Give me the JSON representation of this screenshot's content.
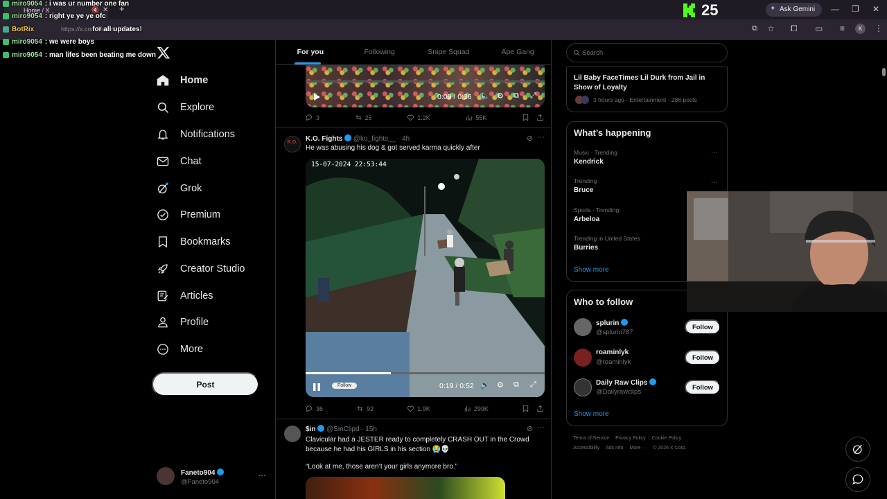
{
  "browser": {
    "tab_title": "Home / X",
    "url": "https://x.com/Faneto904",
    "gemini_label": "Ask Gemini",
    "kick_count": "25"
  },
  "chat": [
    {
      "user": "miro9054",
      "text": ": i was ur number one fan"
    },
    {
      "user": "miro9054",
      "text": ": right ye ye ye ofc"
    },
    {
      "user": "BotRix",
      "text": "for all updates!"
    },
    {
      "user": "miro9054",
      "text": ": we were boys"
    },
    {
      "user": "miro9054",
      "text": ": man lifes been beating me down"
    }
  ],
  "nav": {
    "items": [
      {
        "label": "Home"
      },
      {
        "label": "Explore"
      },
      {
        "label": "Notifications"
      },
      {
        "label": "Chat"
      },
      {
        "label": "Grok"
      },
      {
        "label": "Premium"
      },
      {
        "label": "Bookmarks"
      },
      {
        "label": "Creator Studio"
      },
      {
        "label": "Articles"
      },
      {
        "label": "Profile"
      },
      {
        "label": "More"
      }
    ],
    "post_label": "Post",
    "account_name": "Faneto904",
    "account_handle": "@Faneto904"
  },
  "timeline": {
    "tabs": [
      "For you",
      "Following",
      "Snipe Squad",
      "Ape Gang"
    ],
    "post1": {
      "video_time": "0:09 / 0:36",
      "replies": "3",
      "reposts": "25",
      "likes": "1.2K",
      "views": "55K"
    },
    "post2": {
      "name": "K.O. Fights",
      "handle": "@ko_fights__",
      "time": "· 4h",
      "text": "He was abusing his dog & got served karma quickly after",
      "timestamp_overlay": "15-07-2024 22:53:44",
      "video_time": "0:19 / 0:52",
      "follow_overlay": "Follow",
      "replies": "36",
      "reposts": "92",
      "likes": "1.9K",
      "views": "299K"
    },
    "post3": {
      "name": "$in",
      "handle": "@SinClipd",
      "time": "· 15h",
      "text": "Clavicular had a JESTER ready to completely CRASH OUT in the Crowd because he had his GIRLS in his section 😭💀",
      "quote": "“Look at me, those aren’t your girls anymore bro.”"
    }
  },
  "sidebar": {
    "search_placeholder": "Search",
    "top_story": {
      "title": "Lil Baby FaceTimes Lil Durk from Jail in Show of Loyalty",
      "meta": "3 hours ago · Entertainment · 286 posts"
    },
    "whats_happening": {
      "title": "What’s happening",
      "trends": [
        {
          "category": "Music · Trending",
          "name": "Kendrick"
        },
        {
          "category": "Trending",
          "name": "Bruce"
        },
        {
          "category": "Sports · Trending",
          "name": "Arbeloa"
        },
        {
          "category": "Trending in United States",
          "name": "Burries"
        }
      ],
      "show_more": "Show more"
    },
    "who_to_follow": {
      "title": "Who to follow",
      "accounts": [
        {
          "name": "splurin",
          "handle": "@splurin787",
          "button": "Follow"
        },
        {
          "name": "roaminlyk",
          "handle": "@roaminlyk",
          "button": "Follow"
        },
        {
          "name": "Daily Raw Clips",
          "handle": "@Dailyrawclips",
          "button": "Follow"
        }
      ],
      "show_more": "Show more"
    },
    "footer": {
      "line1": [
        "Terms of Service",
        "Privacy Policy",
        "Cookie Policy"
      ],
      "line2": [
        "Accessibility",
        "Ads info",
        "More ···",
        "© 2026 X Corp."
      ]
    }
  },
  "colors": {
    "accent": "#1d9bf0",
    "kick_green": "#53fc18",
    "background": "#000000"
  }
}
